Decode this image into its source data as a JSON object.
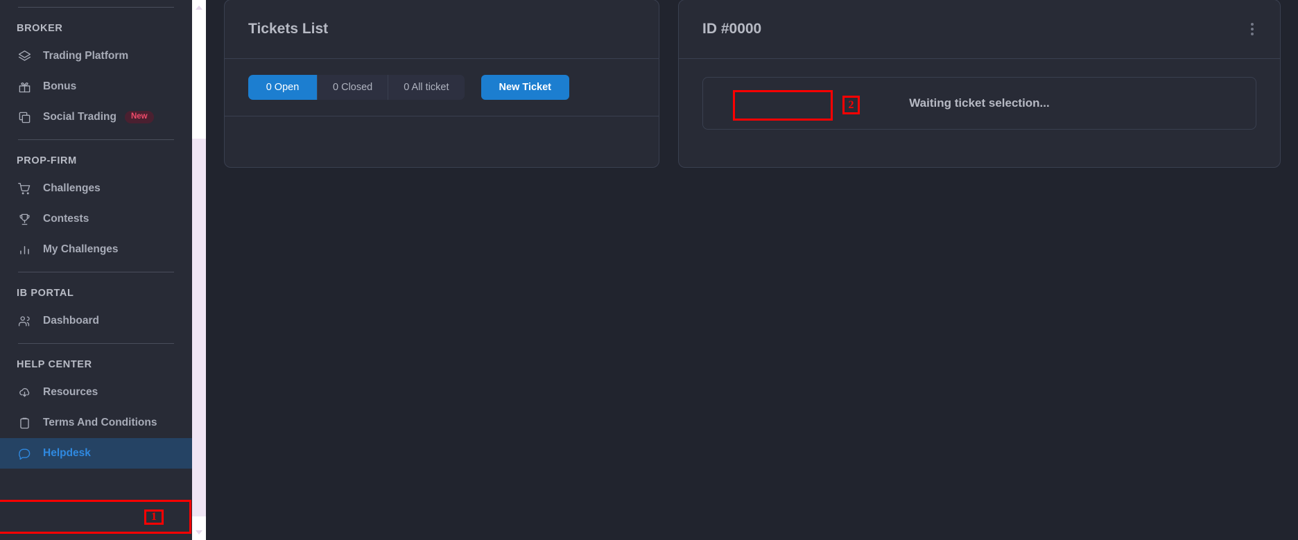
{
  "sidebar": {
    "groups": [
      {
        "title": "BROKER",
        "items": [
          {
            "label": "Trading Platform",
            "icon": "layers-icon"
          },
          {
            "label": "Bonus",
            "icon": "gift-icon"
          },
          {
            "label": "Social Trading",
            "icon": "copy-icon",
            "badge": "New"
          }
        ]
      },
      {
        "title": "PROP-FIRM",
        "items": [
          {
            "label": "Challenges",
            "icon": "cart-icon"
          },
          {
            "label": "Contests",
            "icon": "trophy-icon"
          },
          {
            "label": "My Challenges",
            "icon": "bar-chart-icon"
          }
        ]
      },
      {
        "title": "IB PORTAL",
        "items": [
          {
            "label": "Dashboard",
            "icon": "users-icon"
          }
        ]
      },
      {
        "title": "HELP CENTER",
        "items": [
          {
            "label": "Resources",
            "icon": "cloud-download-icon"
          },
          {
            "label": "Terms And Conditions",
            "icon": "clipboard-icon"
          },
          {
            "label": "Helpdesk",
            "icon": "message-icon",
            "active": true
          }
        ]
      }
    ]
  },
  "tickets_panel": {
    "title": "Tickets List",
    "tabs": [
      {
        "label": "0 Open",
        "selected": true
      },
      {
        "label": "0 Closed",
        "selected": false
      },
      {
        "label": "0 All ticket",
        "selected": false
      }
    ],
    "new_ticket_label": "New Ticket"
  },
  "detail_panel": {
    "title": "ID #0000",
    "kebab_icon": "kebab-menu-icon",
    "empty_message": "Waiting ticket selection..."
  },
  "annotations": [
    {
      "number": "1",
      "target": "helpdesk-sidebar-item"
    },
    {
      "number": "2",
      "target": "new-ticket-button"
    }
  ],
  "colors": {
    "accent_blue": "#1c7ed0",
    "active_item_bg": "#254364",
    "active_item_text": "#2f89e0",
    "sidebar_bg": "#282b36",
    "page_bg": "#21242e",
    "badge_new_text": "#f04b6a",
    "annotation_red": "#fe0000"
  }
}
